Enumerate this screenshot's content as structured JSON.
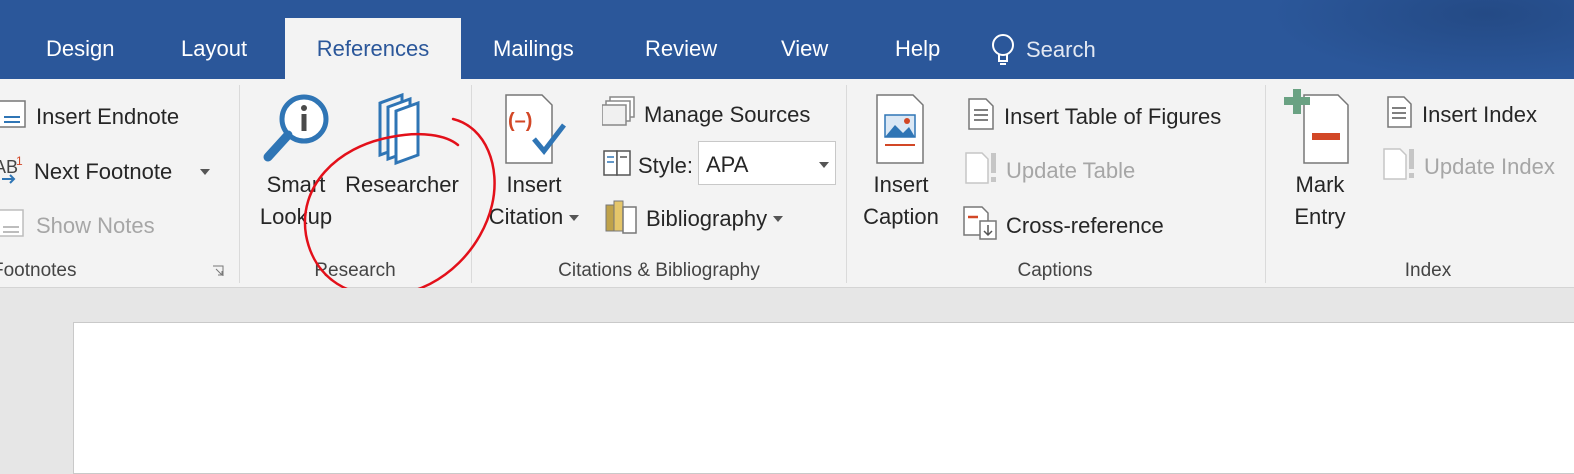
{
  "tabs": [
    {
      "label": "Design"
    },
    {
      "label": "Layout"
    },
    {
      "label": "References"
    },
    {
      "label": "Mailings"
    },
    {
      "label": "Review"
    },
    {
      "label": "View"
    },
    {
      "label": "Help"
    }
  ],
  "search": {
    "label": "Search"
  },
  "footnotes": {
    "insert_endnote": "Insert Endnote",
    "next_footnote": "Next Footnote",
    "show_notes": "Show Notes",
    "group_label": "Footnotes"
  },
  "research": {
    "smart_lookup": [
      "Smart",
      "Lookup"
    ],
    "researcher": "Researcher",
    "group_label": "Research"
  },
  "citations": {
    "insert_citation": [
      "Insert",
      "Citation"
    ],
    "manage_sources": "Manage Sources",
    "style_label": "Style:",
    "style_value": "APA",
    "bibliography": "Bibliography",
    "group_label": "Citations & Bibliography"
  },
  "captions": {
    "insert_caption": [
      "Insert",
      "Caption"
    ],
    "insert_table_of_figures": "Insert Table of Figures",
    "update_table": "Update Table",
    "cross_reference": "Cross-reference",
    "group_label": "Captions"
  },
  "index": {
    "mark_entry": [
      "Mark",
      "Entry"
    ],
    "insert_index": "Insert Index",
    "update_index": "Update Index",
    "group_label": "Index"
  },
  "colors": {
    "title_bar": "#2b579a",
    "ribbon": "#f3f3f3",
    "annotation": "#e3101a",
    "icon_blue": "#2f75b5",
    "icon_red": "#d24726",
    "icon_green": "#6aa283"
  }
}
